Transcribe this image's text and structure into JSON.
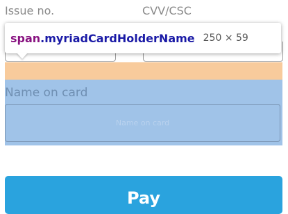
{
  "form": {
    "issue_label": "Issue no.",
    "cvv_label": "CVV/CSC",
    "name_label": "Name on card",
    "name_placeholder": "Name on card",
    "pay_label": "Pay"
  },
  "inspector_tooltip": {
    "tag": "span",
    "class_name": ".myriadCardHolderName",
    "size": "250 × 59"
  },
  "colors": {
    "margin_highlight": "#f8cb9c",
    "content_highlight": "#a0c3e8",
    "pay_button": "#2aa3de"
  }
}
